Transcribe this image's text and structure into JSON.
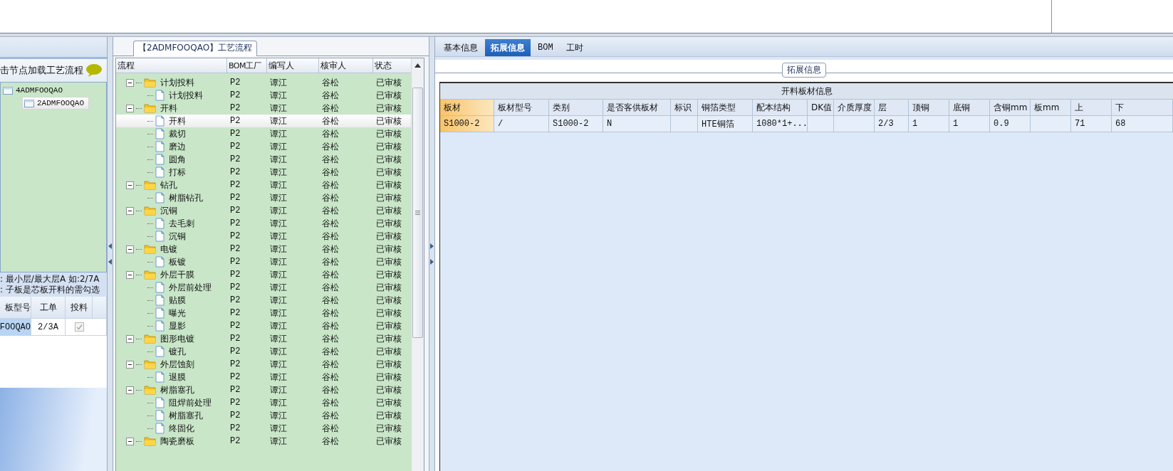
{
  "left_panel": {
    "hint": "击节点加载工艺流程",
    "tree": [
      {
        "label": "4ADMFOOQAO",
        "selected": false,
        "children": [
          {
            "label": "2ADMFOOQAO",
            "selected": true
          }
        ]
      }
    ],
    "notes": [
      ": 最小层/最大层A 如:2/7A",
      ": 子板是芯板开料的需勾选"
    ],
    "grid": {
      "columns": [
        "板型号",
        "工单",
        "投料"
      ],
      "rows": [
        {
          "cells": [
            "FOOQAO",
            "2/3A"
          ],
          "checked": true,
          "selected": true
        }
      ]
    }
  },
  "process_panel": {
    "title": "【2ADMFOOQAO】工艺流程",
    "columns": [
      "流程",
      "BOM工厂",
      "编写人",
      "核审人",
      "状态"
    ],
    "tree": [
      {
        "kind": "folder",
        "label": "计划投料",
        "expanded": true,
        "selected": false,
        "bom": "P2",
        "writer": "谭江",
        "reviewer": "谷松",
        "status": "已审核",
        "children": [
          {
            "kind": "step",
            "label": "计划投料",
            "selected": false,
            "bom": "P2",
            "writer": "谭江",
            "reviewer": "谷松",
            "status": "已审核"
          }
        ]
      },
      {
        "kind": "folder",
        "label": "开料",
        "expanded": true,
        "selected": false,
        "bom": "P2",
        "writer": "谭江",
        "reviewer": "谷松",
        "status": "已审核",
        "children": [
          {
            "kind": "step",
            "label": "开料",
            "selected": true,
            "bom": "P2",
            "writer": "谭江",
            "reviewer": "谷松",
            "status": "已审核"
          },
          {
            "kind": "step",
            "label": "裁切",
            "selected": false,
            "bom": "P2",
            "writer": "谭江",
            "reviewer": "谷松",
            "status": "已审核"
          },
          {
            "kind": "step",
            "label": "磨边",
            "selected": false,
            "bom": "P2",
            "writer": "谭江",
            "reviewer": "谷松",
            "status": "已审核"
          },
          {
            "kind": "step",
            "label": "圆角",
            "selected": false,
            "bom": "P2",
            "writer": "谭江",
            "reviewer": "谷松",
            "status": "已审核"
          },
          {
            "kind": "step",
            "label": "打标",
            "selected": false,
            "bom": "P2",
            "writer": "谭江",
            "reviewer": "谷松",
            "status": "已审核"
          }
        ]
      },
      {
        "kind": "folder",
        "label": "钻孔",
        "expanded": true,
        "selected": false,
        "bom": "P2",
        "writer": "谭江",
        "reviewer": "谷松",
        "status": "已审核",
        "children": [
          {
            "kind": "step",
            "label": "树脂钻孔",
            "selected": false,
            "bom": "P2",
            "writer": "谭江",
            "reviewer": "谷松",
            "status": "已审核"
          }
        ]
      },
      {
        "kind": "folder",
        "label": "沉铜",
        "expanded": true,
        "selected": false,
        "bom": "P2",
        "writer": "谭江",
        "reviewer": "谷松",
        "status": "已审核",
        "children": [
          {
            "kind": "step",
            "label": "去毛刺",
            "selected": false,
            "bom": "P2",
            "writer": "谭江",
            "reviewer": "谷松",
            "status": "已审核"
          },
          {
            "kind": "step",
            "label": "沉铜",
            "selected": false,
            "bom": "P2",
            "writer": "谭江",
            "reviewer": "谷松",
            "status": "已审核"
          }
        ]
      },
      {
        "kind": "folder",
        "label": "电镀",
        "expanded": true,
        "selected": false,
        "bom": "P2",
        "writer": "谭江",
        "reviewer": "谷松",
        "status": "已审核",
        "children": [
          {
            "kind": "step",
            "label": "板镀",
            "selected": false,
            "bom": "P2",
            "writer": "谭江",
            "reviewer": "谷松",
            "status": "已审核"
          }
        ]
      },
      {
        "kind": "folder",
        "label": "外层干膜",
        "expanded": true,
        "selected": false,
        "bom": "P2",
        "writer": "谭江",
        "reviewer": "谷松",
        "status": "已审核",
        "children": [
          {
            "kind": "step",
            "label": "外层前处理",
            "selected": false,
            "bom": "P2",
            "writer": "谭江",
            "reviewer": "谷松",
            "status": "已审核"
          },
          {
            "kind": "step",
            "label": "贴膜",
            "selected": false,
            "bom": "P2",
            "writer": "谭江",
            "reviewer": "谷松",
            "status": "已审核"
          },
          {
            "kind": "step",
            "label": "曝光",
            "selected": false,
            "bom": "P2",
            "writer": "谭江",
            "reviewer": "谷松",
            "status": "已审核"
          },
          {
            "kind": "step",
            "label": "显影",
            "selected": false,
            "bom": "P2",
            "writer": "谭江",
            "reviewer": "谷松",
            "status": "已审核"
          }
        ]
      },
      {
        "kind": "folder",
        "label": "图形电镀",
        "expanded": true,
        "selected": false,
        "bom": "P2",
        "writer": "谭江",
        "reviewer": "谷松",
        "status": "已审核",
        "children": [
          {
            "kind": "step",
            "label": "镀孔",
            "selected": false,
            "bom": "P2",
            "writer": "谭江",
            "reviewer": "谷松",
            "status": "已审核"
          }
        ]
      },
      {
        "kind": "folder",
        "label": "外层蚀刻",
        "expanded": true,
        "selected": false,
        "bom": "P2",
        "writer": "谭江",
        "reviewer": "谷松",
        "status": "已审核",
        "children": [
          {
            "kind": "step",
            "label": "退膜",
            "selected": false,
            "bom": "P2",
            "writer": "谭江",
            "reviewer": "谷松",
            "status": "已审核"
          }
        ]
      },
      {
        "kind": "folder",
        "label": "树脂塞孔",
        "expanded": true,
        "selected": false,
        "bom": "P2",
        "writer": "谭江",
        "reviewer": "谷松",
        "status": "已审核",
        "children": [
          {
            "kind": "step",
            "label": "阻焊前处理",
            "selected": false,
            "bom": "P2",
            "writer": "谭江",
            "reviewer": "谷松",
            "status": "已审核"
          },
          {
            "kind": "step",
            "label": "树脂塞孔",
            "selected": false,
            "bom": "P2",
            "writer": "谭江",
            "reviewer": "谷松",
            "status": "已审核"
          },
          {
            "kind": "step",
            "label": "终固化",
            "selected": false,
            "bom": "P2",
            "writer": "谭江",
            "reviewer": "谷松",
            "status": "已审核"
          }
        ]
      },
      {
        "kind": "folder",
        "label": "陶瓷磨板",
        "expanded": true,
        "selected": false,
        "bom": "P2",
        "writer": "谭江",
        "reviewer": "谷松",
        "status": "已审核"
      }
    ]
  },
  "detail_panel": {
    "tabs": [
      {
        "label": "基本信息",
        "selected": false
      },
      {
        "label": "拓展信息",
        "selected": true
      },
      {
        "label": "BOM",
        "selected": false
      },
      {
        "label": "工时",
        "selected": false
      }
    ],
    "group_title": "拓展信息",
    "table": {
      "title": "开料板材信息",
      "columns": [
        {
          "label": "板材",
          "selected": true
        },
        {
          "label": "板材型号",
          "selected": false
        },
        {
          "label": "类别",
          "selected": false
        },
        {
          "label": "是否客供板材",
          "selected": false
        },
        {
          "label": "标识",
          "selected": false
        },
        {
          "label": "铜箔类型",
          "selected": false
        },
        {
          "label": "配本结构",
          "selected": false
        },
        {
          "label": "DK值",
          "selected": false
        },
        {
          "label": "介质厚度",
          "selected": false
        },
        {
          "label": "层",
          "selected": false
        },
        {
          "label": "顶铜",
          "selected": false
        },
        {
          "label": "底铜",
          "selected": false
        },
        {
          "label": "含铜mm",
          "selected": false
        },
        {
          "label": "板mm",
          "selected": false
        },
        {
          "label": "上",
          "selected": false
        },
        {
          "label": "下",
          "selected": false
        }
      ],
      "rows": [
        [
          "S1000-2",
          "/",
          "S1000-2",
          "N",
          null,
          "HTE铜箔",
          "1080*1+...",
          null,
          null,
          "2/3",
          "1",
          "1",
          "0.9",
          null,
          "71",
          "68"
        ]
      ]
    }
  }
}
